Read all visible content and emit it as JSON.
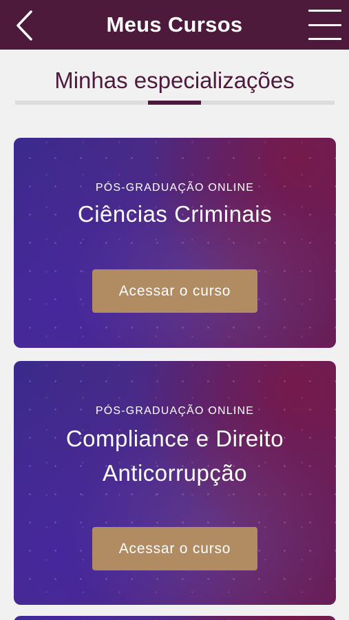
{
  "header": {
    "title": "Meus Cursos",
    "back_icon": "chevron-left-icon",
    "menu_icon": "hamburger-menu-icon",
    "background_color": "#4e1a3c"
  },
  "section": {
    "title": "Minhas especializações"
  },
  "courses": [
    {
      "eyebrow": "PÓS-GRADUAÇÃO ONLINE",
      "name": "Ciências Criminais",
      "button_label": "Acessar o curso"
    },
    {
      "eyebrow": "PÓS-GRADUAÇÃO ONLINE",
      "name": "Compliance e Direito Anticorrupção",
      "button_label": "Acessar o curso"
    }
  ],
  "colors": {
    "accent": "#4e1a3c",
    "button": "#b18c62",
    "background": "#f1f1f1"
  }
}
